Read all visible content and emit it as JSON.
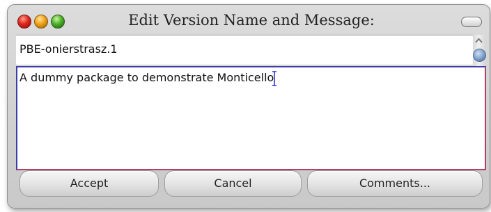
{
  "window": {
    "title": "Edit Version Name and Message:"
  },
  "version": {
    "name": "PBE-onierstrasz.1"
  },
  "message": {
    "text": "A dummy package to demonstrate Monticello"
  },
  "buttons": {
    "accept": "Accept",
    "cancel": "Cancel",
    "comments": "Comments..."
  },
  "colors": {
    "close": "#e0251b",
    "minimize": "#f0a31a",
    "zoom": "#4caf2a",
    "focus_border": "#3b3ea8",
    "scroll_thumb": "#7a9cc8"
  },
  "icons": {
    "close": "close-dot-icon",
    "minimize": "minimize-dot-icon",
    "zoom": "zoom-dot-icon",
    "collapse": "collapse-pill-icon",
    "scroll_up": "chevron-up-icon",
    "scroll_down": "chevron-down-icon",
    "caret": "text-cursor-icon"
  }
}
